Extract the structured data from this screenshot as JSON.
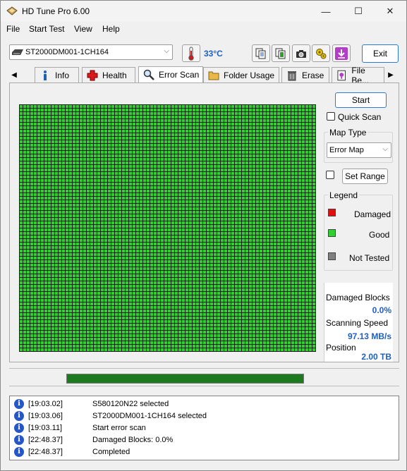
{
  "window": {
    "title": "HD Tune Pro 6.00"
  },
  "window_controls": {
    "minimize": "—",
    "maximize": "☐",
    "close": "✕"
  },
  "menu": [
    "File",
    "Start Test",
    "View",
    "Help"
  ],
  "toolbar": {
    "drive": "ST2000DM001-1CH164",
    "temperature": "33°C",
    "exit_label": "Exit"
  },
  "tabs": [
    {
      "label": "Info",
      "icon": "info-icon"
    },
    {
      "label": "Health",
      "icon": "health-cross-icon"
    },
    {
      "label": "Error Scan",
      "icon": "magnifier-icon",
      "active": true
    },
    {
      "label": "Folder Usage",
      "icon": "folder-icon"
    },
    {
      "label": "Erase",
      "icon": "trash-icon"
    },
    {
      "label": "File Be...",
      "icon": "file-benchmark-icon"
    }
  ],
  "scan": {
    "start_label": "Start",
    "quick_scan_label": "Quick Scan",
    "map_type_title": "Map Type",
    "map_type_value": "Error Map",
    "set_range_label": "Set Range",
    "legend_title": "Legend",
    "legend": [
      {
        "label": "Damaged",
        "color": "#e01010"
      },
      {
        "label": "Good",
        "color": "#2ed12e"
      },
      {
        "label": "Not Tested",
        "color": "#808080"
      }
    ],
    "stats": {
      "damaged_blocks_label": "Damaged Blocks",
      "damaged_blocks_value": "0.0%",
      "scanning_speed_label": "Scanning Speed",
      "scanning_speed_value": "97.13 MB/s",
      "position_label": "Position",
      "position_value": "2.00 TB"
    },
    "grid_color_good": "#2ed12e",
    "progress_fraction": 1.0
  },
  "log": [
    {
      "time": "[19:03.02]",
      "message": "S580120N22 selected"
    },
    {
      "time": "[19:03.06]",
      "message": "ST2000DM001-1CH164 selected"
    },
    {
      "time": "[19:03.11]",
      "message": "Start error scan"
    },
    {
      "time": "[22:48.37]",
      "message": "Damaged Blocks: 0.0%"
    },
    {
      "time": "[22:48.37]",
      "message": "Completed"
    }
  ]
}
